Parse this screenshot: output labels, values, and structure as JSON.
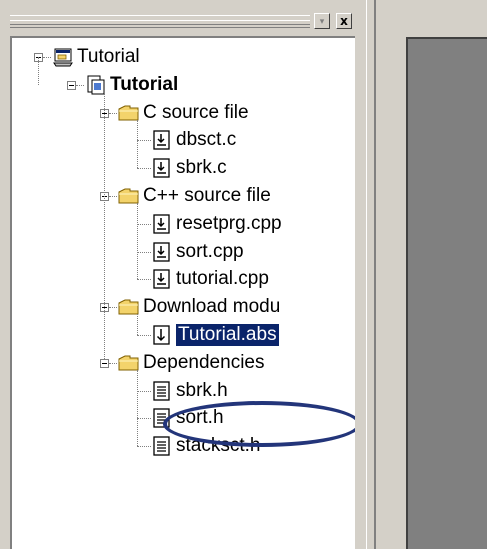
{
  "window": {
    "close_glyph": "x",
    "menu_glyph": "▾"
  },
  "tree": {
    "workspace": {
      "label": "Tutorial",
      "icon": "workspace-icon"
    },
    "project": {
      "label": "Tutorial",
      "icon": "project-icon"
    },
    "folders": [
      {
        "label": "C source file",
        "icon": "folder-icon",
        "files": [
          {
            "label": "dbsct.c",
            "icon": "source-file-icon"
          },
          {
            "label": "sbrk.c",
            "icon": "source-file-icon"
          }
        ]
      },
      {
        "label": "C++ source file",
        "icon": "folder-icon",
        "files": [
          {
            "label": "resetprg.cpp",
            "icon": "source-file-icon"
          },
          {
            "label": "sort.cpp",
            "icon": "source-file-icon"
          },
          {
            "label": "tutorial.cpp",
            "icon": "source-file-icon"
          }
        ]
      },
      {
        "label": "Download modu",
        "icon": "folder-icon",
        "files": [
          {
            "label": "Tutorial.abs",
            "icon": "download-module-icon",
            "selected": true
          }
        ]
      },
      {
        "label": "Dependencies",
        "icon": "folder-icon",
        "files": [
          {
            "label": "sbrk.h",
            "icon": "header-file-icon"
          },
          {
            "label": "sort.h",
            "icon": "header-file-icon"
          },
          {
            "label": "stacksct.h",
            "icon": "header-file-icon"
          }
        ]
      }
    ]
  },
  "colors": {
    "selection": "#0a246a",
    "highlight_ring": "#23357a",
    "folder": "#f3d36b",
    "editor_bg": "#808080"
  }
}
